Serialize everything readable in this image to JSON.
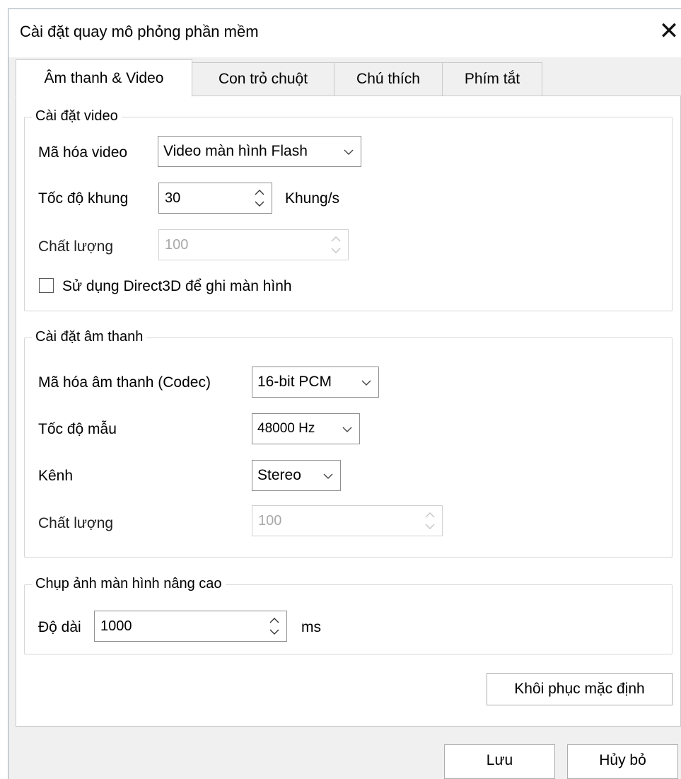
{
  "window": {
    "title": "Cài đặt quay mô phỏng phần mềm",
    "close_glyph": "✕"
  },
  "tabs": [
    {
      "label": "Âm thanh & Video",
      "active": true
    },
    {
      "label": "Con trỏ chuột",
      "active": false
    },
    {
      "label": "Chú thích",
      "active": false
    },
    {
      "label": "Phím tắt",
      "active": false
    }
  ],
  "video": {
    "legend": "Cài đặt video",
    "encoding_label": "Mã hóa video",
    "encoding_value": "Video màn hình Flash",
    "framerate_label": "Tốc độ khung",
    "framerate_value": "30",
    "framerate_unit": "Khung/s",
    "quality_label": "Chất lượng",
    "quality_value": "100",
    "direct3d_label": "Sử dụng Direct3D để ghi màn hình",
    "direct3d_checked": false
  },
  "audio": {
    "legend": "Cài đặt âm thanh",
    "codec_label": "Mã hóa âm thanh (Codec)",
    "codec_value": "16-bit PCM",
    "samplerate_label": "Tốc độ mẫu",
    "samplerate_value": "48000 Hz",
    "channel_label": "Kênh",
    "channel_value": "Stereo",
    "quality_label": "Chất lượng",
    "quality_value": "100"
  },
  "advanced": {
    "legend": "Chụp ảnh màn hình nâng cao",
    "duration_label": "Độ dài",
    "duration_value": "1000",
    "duration_unit": "ms"
  },
  "buttons": {
    "restore_defaults": "Khôi phục mặc định",
    "save": "Lưu",
    "cancel": "Hủy bỏ"
  },
  "colors": {
    "dialog_bg": "#f0f0f0",
    "panel_bg": "#ffffff",
    "border": "#adadad",
    "disabled_text": "#a8a8a8"
  }
}
